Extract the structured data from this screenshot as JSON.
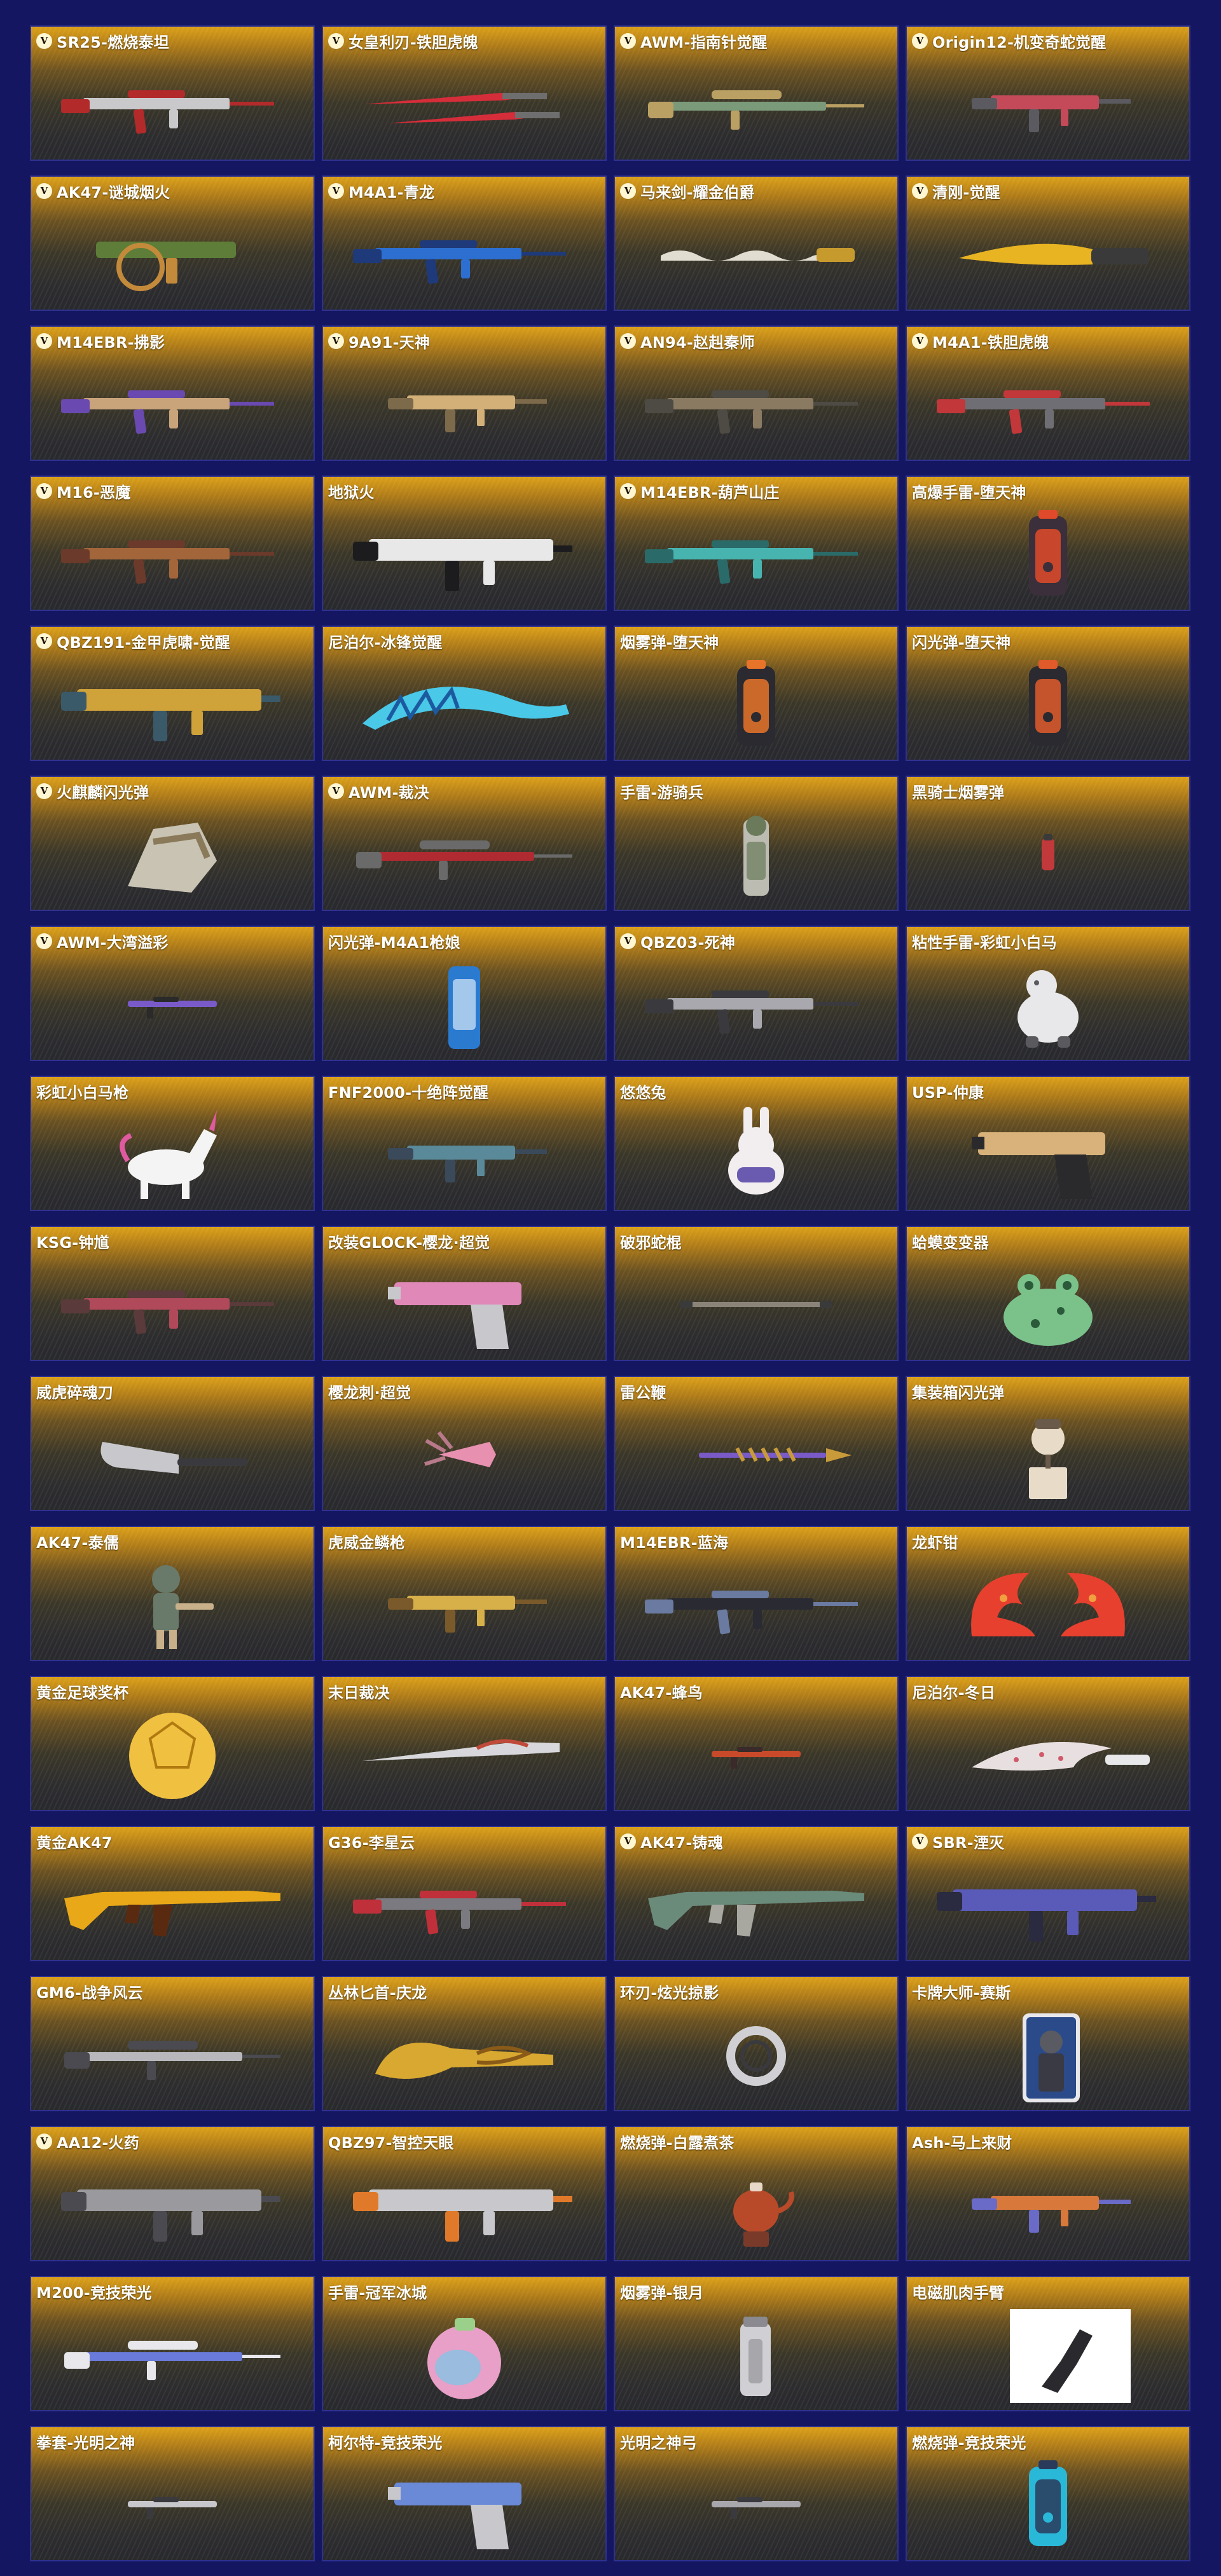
{
  "items": [
    {
      "name": "SR25-燃烧泰坦",
      "badge": "V",
      "kind": "rifle",
      "colors": [
        "#c9c9cc",
        "#b22a2a"
      ]
    },
    {
      "name": "女皇利刃-铁胆虎魄",
      "badge": "V",
      "kind": "blades",
      "colors": [
        "#d62d3a",
        "#6e6e6e"
      ]
    },
    {
      "name": "AWM-指南针觉醒",
      "badge": "V",
      "kind": "sniper",
      "colors": [
        "#7b9a7a",
        "#bba063"
      ]
    },
    {
      "name": "Origin12-机变奇蛇觉醒",
      "badge": "V",
      "kind": "smg",
      "colors": [
        "#c44a5a",
        "#5a5a60"
      ]
    },
    {
      "name": "AK47-谜城烟火",
      "badge": "V",
      "kind": "launcher",
      "colors": [
        "#5d7d38",
        "#c28a3a"
      ]
    },
    {
      "name": "M4A1-青龙",
      "badge": "V",
      "kind": "rifle",
      "colors": [
        "#2c6fd0",
        "#1e3a7a"
      ]
    },
    {
      "name": "马来剑-耀金伯爵",
      "badge": "V",
      "kind": "wavy",
      "colors": [
        "#e2ddd1",
        "#c79a2e"
      ]
    },
    {
      "name": "清刚-觉醒",
      "badge": "V",
      "kind": "knife",
      "colors": [
        "#e8b422",
        "#3a3a3a"
      ]
    },
    {
      "name": "M14EBR-拂影",
      "badge": "V",
      "kind": "rifle",
      "colors": [
        "#c9a37a",
        "#6a4ab0"
      ]
    },
    {
      "name": "9A91-天神",
      "badge": "V",
      "kind": "smg",
      "colors": [
        "#d2b078",
        "#7d6a4a"
      ]
    },
    {
      "name": "AN94-赵赳秦师",
      "badge": "V",
      "kind": "rifle",
      "colors": [
        "#8a7a62",
        "#4e4b45"
      ]
    },
    {
      "name": "M4A1-铁胆虎魄",
      "badge": "V",
      "kind": "rifle",
      "colors": [
        "#6e6e74",
        "#c2373a"
      ]
    },
    {
      "name": "M16-恶魔",
      "badge": "V",
      "kind": "rifle",
      "colors": [
        "#a2663a",
        "#6b3a2a"
      ]
    },
    {
      "name": "地狱火",
      "badge": "",
      "kind": "heavy",
      "colors": [
        "#e8e8e8",
        "#1c1c1e"
      ]
    },
    {
      "name": "M14EBR-葫芦山庄",
      "badge": "V",
      "kind": "rifle",
      "colors": [
        "#48b4b0",
        "#2a6b6a"
      ]
    },
    {
      "name": "高爆手雷-堕天神",
      "badge": "",
      "kind": "canister",
      "colors": [
        "#3a2f3a",
        "#e04a2a"
      ]
    },
    {
      "name": "QBZ191-金甲虎啸-觉醒",
      "badge": "V",
      "kind": "heavy",
      "colors": [
        "#d0a23a",
        "#3a5a6a"
      ]
    },
    {
      "name": "尼泊尔-冰锋觉醒",
      "badge": "",
      "kind": "scythe",
      "colors": [
        "#49c8e8",
        "#1c5aa0"
      ]
    },
    {
      "name": "烟雾弹-堕天神",
      "badge": "",
      "kind": "canister",
      "colors": [
        "#2a2a30",
        "#e8742a"
      ]
    },
    {
      "name": "闪光弹-堕天神",
      "badge": "",
      "kind": "canister",
      "colors": [
        "#2a2a30",
        "#e05a2a"
      ]
    },
    {
      "name": "火麒麟闪光弹",
      "badge": "V",
      "kind": "gauntlet",
      "colors": [
        "#c8c3b3",
        "#8a7a5a"
      ]
    },
    {
      "name": "AWM-裁决",
      "badge": "V",
      "kind": "sniper",
      "colors": [
        "#b02a32",
        "#6a6a6a"
      ]
    },
    {
      "name": "手雷-游骑兵",
      "badge": "",
      "kind": "totem",
      "colors": [
        "#bcbcb2",
        "#6a7a5a"
      ]
    },
    {
      "name": "黑骑士烟雾弹",
      "badge": "",
      "kind": "small",
      "colors": [
        "#c2393c",
        "#3a3a3a"
      ]
    },
    {
      "name": "AWM-大湾溢彩",
      "badge": "V",
      "kind": "tiny",
      "colors": [
        "#7a5ac8",
        "#2a2a2a"
      ]
    },
    {
      "name": "闪光弹-M4A1枪娘",
      "badge": "",
      "kind": "can",
      "colors": [
        "#2a7ad0",
        "#d8e8f8"
      ]
    },
    {
      "name": "QBZ03-死神",
      "badge": "V",
      "kind": "rifle",
      "colors": [
        "#a8a8ae",
        "#3a3a3e"
      ]
    },
    {
      "name": "粘性手雷-彩虹小白马",
      "badge": "",
      "kind": "critter",
      "colors": [
        "#e8e8ea",
        "#5a5a5e"
      ]
    },
    {
      "name": "彩虹小白马枪",
      "badge": "",
      "kind": "unicorn",
      "colors": [
        "#f4f4f4",
        "#e05aa0"
      ]
    },
    {
      "name": "FNF2000-十绝阵觉醒",
      "badge": "",
      "kind": "smg",
      "colors": [
        "#5a8a9a",
        "#3a4a5a"
      ]
    },
    {
      "name": "悠悠兔",
      "badge": "",
      "kind": "bunny",
      "colors": [
        "#f2eef0",
        "#6a5ab0"
      ]
    },
    {
      "name": "USP-仲康",
      "badge": "",
      "kind": "pistol",
      "colors": [
        "#d8b27a",
        "#2a2a2c"
      ]
    },
    {
      "name": "KSG-钟馗",
      "badge": "",
      "kind": "rifle",
      "colors": [
        "#b04a5a",
        "#5a3a3a"
      ]
    },
    {
      "name": "改装GLOCK-樱龙·超觉",
      "badge": "",
      "kind": "pistol",
      "colors": [
        "#e088b8",
        "#c8c8cc"
      ]
    },
    {
      "name": "破邪蛇棍",
      "badge": "",
      "kind": "staff",
      "colors": [
        "#8a8478",
        "#3a3a3a"
      ]
    },
    {
      "name": "蛤蟆变变器",
      "badge": "",
      "kind": "frog",
      "colors": [
        "#7ac28a",
        "#2a5a3a"
      ]
    },
    {
      "name": "威虎碎魂刀",
      "badge": "",
      "kind": "cleaver",
      "colors": [
        "#c8c8cc",
        "#3a3a3e"
      ]
    },
    {
      "name": "樱龙刺·超觉",
      "badge": "",
      "kind": "claw",
      "colors": [
        "#e890b0",
        "#b87a8a"
      ]
    },
    {
      "name": "雷公鞭",
      "badge": "",
      "kind": "spear",
      "colors": [
        "#7a5ac8",
        "#c89a3a"
      ]
    },
    {
      "name": "集装箱闪光弹",
      "badge": "",
      "kind": "jackbox",
      "colors": [
        "#e8dcc8",
        "#6a5a4a"
      ]
    },
    {
      "name": "AK47-泰儒",
      "badge": "",
      "kind": "figure",
      "colors": [
        "#6a7a6a",
        "#c8b08a"
      ]
    },
    {
      "name": "虎威金鳞枪",
      "badge": "",
      "kind": "smg",
      "colors": [
        "#d8b04a",
        "#7a5a2a"
      ]
    },
    {
      "name": "M14EBR-蓝海",
      "badge": "",
      "kind": "rifle",
      "colors": [
        "#2a2a32",
        "#6a7aa0"
      ]
    },
    {
      "name": "龙虾钳",
      "badge": "",
      "kind": "claws",
      "colors": [
        "#e8402e",
        "#f0a040"
      ]
    },
    {
      "name": "黄金足球奖杯",
      "badge": "",
      "kind": "ball",
      "colors": [
        "#f0c040",
        "#b07a10"
      ]
    },
    {
      "name": "末日裁决",
      "badge": "",
      "kind": "blade",
      "colors": [
        "#d8d8dc",
        "#c04a3a"
      ]
    },
    {
      "name": "AK47-蜂鸟",
      "badge": "",
      "kind": "tiny",
      "colors": [
        "#c84a2a",
        "#3a2a2a"
      ]
    },
    {
      "name": "尼泊尔-冬日",
      "badge": "",
      "kind": "kukri",
      "colors": [
        "#e8e0e0",
        "#d05a6a"
      ]
    },
    {
      "name": "黄金AK47",
      "badge": "",
      "kind": "ak",
      "colors": [
        "#e8a818",
        "#5a2a10"
      ]
    },
    {
      "name": "G36-李星云",
      "badge": "",
      "kind": "rifle",
      "colors": [
        "#7a7a80",
        "#c0303a"
      ]
    },
    {
      "name": "AK47-铸魂",
      "badge": "V",
      "kind": "ak",
      "colors": [
        "#6a8a7a",
        "#a8a8a0"
      ]
    },
    {
      "name": "SBR-湮灭",
      "badge": "V",
      "kind": "heavy",
      "colors": [
        "#5a5ab8",
        "#2a2a40"
      ]
    },
    {
      "name": "GM6-战争风云",
      "badge": "",
      "kind": "sniper",
      "colors": [
        "#b8b8bc",
        "#4a4a50"
      ]
    },
    {
      "name": "丛林匕首-庆龙",
      "badge": "",
      "kind": "dagger",
      "colors": [
        "#d8a830",
        "#8a5a18"
      ]
    },
    {
      "name": "环刃-炫光掠影",
      "badge": "",
      "kind": "ring",
      "colors": [
        "#d0d0d4",
        "#3a3a3e"
      ]
    },
    {
      "name": "卡牌大师-赛斯",
      "badge": "",
      "kind": "card",
      "colors": [
        "#2a4a8a",
        "#e8e8ec"
      ]
    },
    {
      "name": "AA12-火药",
      "badge": "V",
      "kind": "heavy",
      "colors": [
        "#9a9a9e",
        "#4a4a50"
      ]
    },
    {
      "name": "QBZ97-智控天眼",
      "badge": "",
      "kind": "heavy",
      "colors": [
        "#c8c8cc",
        "#e07a2a"
      ]
    },
    {
      "name": "燃烧弹-白露煮茶",
      "badge": "",
      "kind": "teapot",
      "colors": [
        "#b84a2a",
        "#e8d8c8"
      ]
    },
    {
      "name": "Ash-马上来财",
      "badge": "",
      "kind": "smg",
      "colors": [
        "#d8783a",
        "#6a6ac8"
      ]
    },
    {
      "name": "M200-竞技荣光",
      "badge": "",
      "kind": "sniper",
      "colors": [
        "#6a7ad8",
        "#e8e8ec"
      ]
    },
    {
      "name": "手雷-冠军冰城",
      "badge": "",
      "kind": "grenade",
      "colors": [
        "#e8a0c8",
        "#78c8e8"
      ]
    },
    {
      "name": "烟雾弹-银月",
      "badge": "",
      "kind": "silvercan",
      "colors": [
        "#d0d0d4",
        "#8a8a90"
      ]
    },
    {
      "name": "电磁肌肉手臂",
      "badge": "",
      "kind": "photo",
      "colors": [
        "#ffffff",
        "#2a2a2e"
      ]
    },
    {
      "name": "拳套-光明之神",
      "badge": "",
      "kind": "tiny",
      "colors": [
        "#c8c8cc",
        "#3a3a3e"
      ]
    },
    {
      "name": "柯尔特-竞技荣光",
      "badge": "",
      "kind": "pistol",
      "colors": [
        "#6a8ad8",
        "#c8c8cc"
      ]
    },
    {
      "name": "光明之神弓",
      "badge": "",
      "kind": "tiny",
      "colors": [
        "#a8a8ac",
        "#3a3a3e"
      ]
    },
    {
      "name": "燃烧弹-竞技荣光",
      "badge": "",
      "kind": "canister",
      "colors": [
        "#2ab8d8",
        "#2a3a5a"
      ]
    }
  ]
}
